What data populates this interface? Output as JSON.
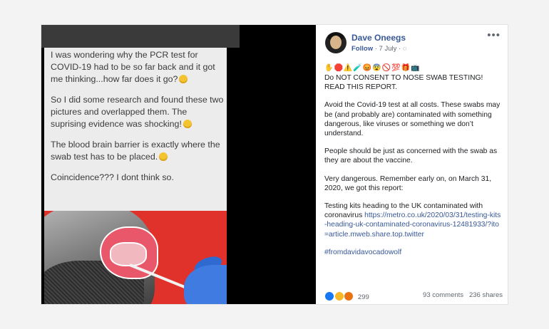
{
  "media": {
    "caption_paragraphs": [
      "I was wondering why the PCR test for COVID-19 had to be so far back and it got me thinking...how far does it go?",
      "So I  did some research and found these two pictures and overlapped them. The suprising evidence was shocking!",
      "The blood brain barrier is exactly where the swab test has to be placed.",
      "Coincidence??? I dont think so."
    ]
  },
  "post": {
    "author": "Dave Oneegs",
    "follow_label": "Follow",
    "date": "7 July",
    "separator": "·",
    "more_icon": "more-dots-icon",
    "emoji_row": "✋🛑⚠️🧪😡😨🚫💯🎁📺",
    "paragraphs": [
      "Do NOT CONSENT TO NOSE SWAB TESTING! READ THIS REPORT.",
      "Avoid the Covid-19 test at all costs. These swabs may be (and probably are) contaminated with something dangerous, like viruses or something we don’t understand.",
      "People should be just as concerned with the swab as they are about the vaccine.",
      "Very dangerous. Remember early on, on March 31, 2020, we got this report:"
    ],
    "link_intro": "Testing kits heading to the UK contaminated with coronavirus ",
    "link_url": "https://metro.co.uk/2020/03/31/testing-kits-heading-uk-contaminated-coronavirus-12481933/?ito=article.mweb.share.top.twitter",
    "hashtag": "#fromdavidavocadowolf",
    "reactions_count": "299",
    "comments": "93 comments",
    "shares": "236 shares"
  },
  "colors": {
    "link": "#385898",
    "illustration_red": "#e0322a",
    "glove_blue": "#3f7be0"
  }
}
